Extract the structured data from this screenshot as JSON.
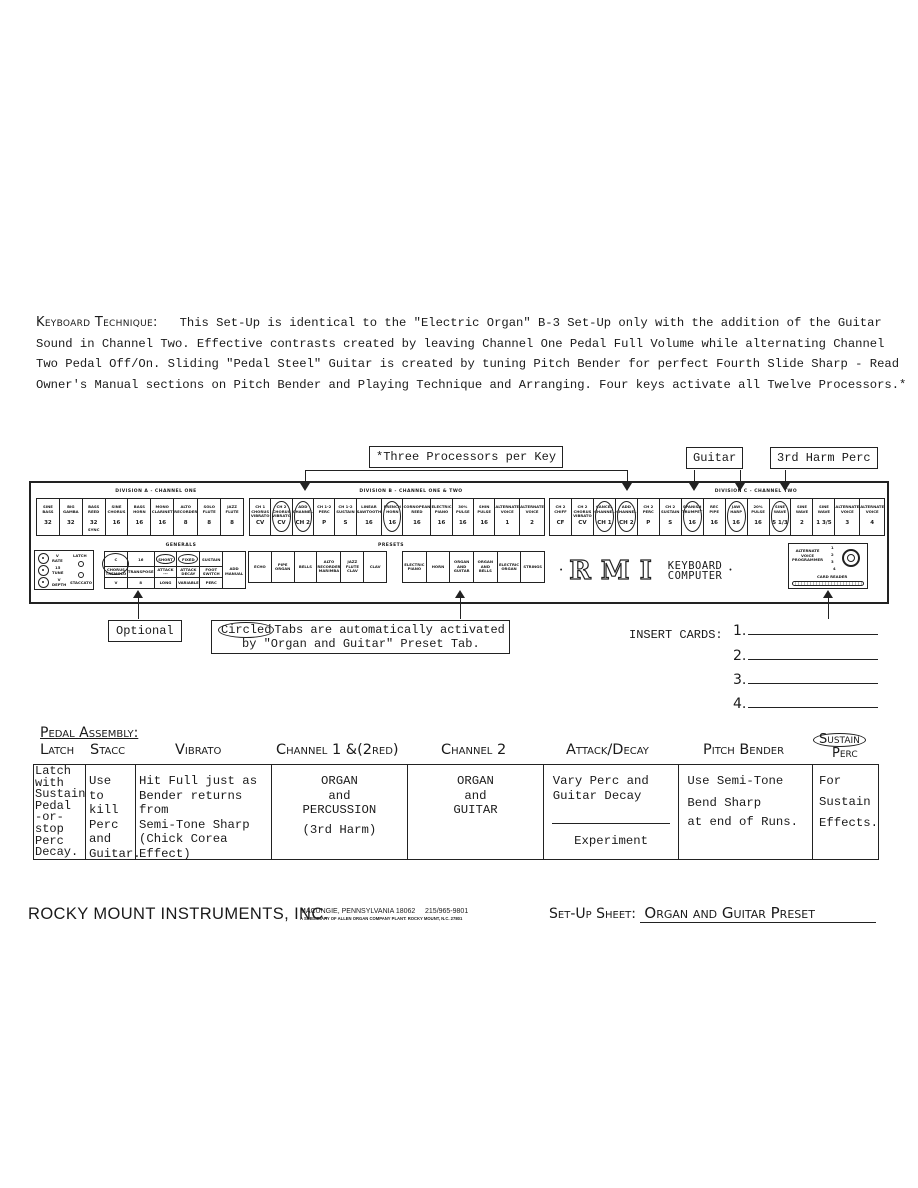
{
  "keyboard_technique": {
    "heading": "Keyboard Technique:",
    "lines": [
      "This Set-Up is identical to the \"Electric Organ\" B-3 Set-Up only with the addition of the Guitar",
      "Sound in Channel Two.  Effective contrasts created by leaving Channel One Pedal Full Volume while alternating Channel",
      "Two Pedal Off/On.  Sliding \"Pedal Steel\" Guitar is created by tuning Pitch Bender for perfect Fourth Slide Sharp - Read",
      "Owner's Manual sections on Pitch Bender and Playing Technique and Arranging.  Four keys activate all Twelve Processors.*"
    ]
  },
  "callouts": {
    "three_processors": "*Three Processors per Key",
    "guitar": "Guitar",
    "third_harm": "3rd Harm Perc",
    "optional": "Optional",
    "circled_word": "Circled",
    "circled_rest": "Tabs are automatically activated",
    "circled_line2": "by \"Organ and Guitar\" Preset Tab."
  },
  "panel": {
    "division_a": {
      "label": "DIVISION A - CHANNEL ONE",
      "tabs": [
        {
          "name": "SINE\nBASS",
          "value": "32"
        },
        {
          "name": "BIG\nGAMBA",
          "value": "32"
        },
        {
          "name": "BASS\nREED",
          "value": "32",
          "extra": "SYNC"
        },
        {
          "name": "SINE\nCHORUS",
          "value": "16"
        },
        {
          "name": "BASS\nHORN",
          "value": "16"
        },
        {
          "name": "MONO\nCLARINET",
          "value": "16"
        },
        {
          "name": "ALTO\nRECORDER",
          "value": "8"
        },
        {
          "name": "SOLO\nFLUTE",
          "value": "8"
        },
        {
          "name": "JAZZ\nFLUTE",
          "value": "8"
        }
      ]
    },
    "division_b": {
      "label": "DIVISION B - CHANNEL ONE & TWO",
      "tabs": [
        {
          "name": "CH 1\nCHORUS\nVIBRATO",
          "value": "CV"
        },
        {
          "name": "CH 2\nCHORUS\nVIBRATO",
          "value": "CV",
          "circled": true
        },
        {
          "name": "ADD\nCHANNEL",
          "value": "CH 2",
          "circled": true
        },
        {
          "name": "CH 1-2\nPERC",
          "value": "P"
        },
        {
          "name": "CH 1-2\nSUSTAIN",
          "value": "S"
        },
        {
          "name": "LINEAR\nSAWTOOTH",
          "value": "16"
        },
        {
          "name": "FRENCH\nHORN",
          "value": "16",
          "circled": true
        },
        {
          "name": "CORNOPEAN\nREED",
          "value": "16"
        },
        {
          "name": "ELECTRIC\nPIANO",
          "value": "16"
        },
        {
          "name": "30%\nPULSE",
          "value": "16"
        },
        {
          "name": "SHIN\nPULSE",
          "value": "16"
        },
        {
          "name": "ALTERNATE\nVOICE",
          "value": "1"
        },
        {
          "name": "ALTERNATE\nVOICE",
          "value": "2"
        }
      ]
    },
    "division_c": {
      "label": "DIVISION C - CHANNEL TWO",
      "tabs": [
        {
          "name": "CH 2\nCHIFF",
          "value": "CF"
        },
        {
          "name": "CH 2\nCHORUS\nVIBRATO",
          "value": "CV"
        },
        {
          "name": "CANCEL\nCHANNEL",
          "value": "CH 1",
          "circled": true
        },
        {
          "name": "ADD\nCHANNEL",
          "value": "CH 2",
          "circled": true
        },
        {
          "name": "CH 2\nPERC",
          "value": "P"
        },
        {
          "name": "CH 2\nSUSTAIN",
          "value": "S"
        },
        {
          "name": "SPANISH\nTRUMPET",
          "value": "16",
          "circled": true
        },
        {
          "name": "REC\nPIPE",
          "value": "16"
        },
        {
          "name": "JAW\nHARP",
          "value": "16",
          "circled": true
        },
        {
          "name": "20%\nPULSE",
          "value": "16"
        },
        {
          "name": "SINE\nWAVE",
          "value": "5 1/3",
          "circled": true
        },
        {
          "name": "SINE\nWAVE",
          "value": "2"
        },
        {
          "name": "SINE\nWAVE",
          "value": "1 3/5"
        },
        {
          "name": "ALTERNATE\nVOICE",
          "value": "3"
        },
        {
          "name": "ALTERNATE\nVOICE",
          "value": "4"
        }
      ]
    },
    "controls": {
      "knobs": [
        {
          "label": "V\nRATE"
        },
        {
          "label": "15\nTUNE"
        },
        {
          "label": "V\nDEPTH"
        }
      ],
      "latch": "LATCH",
      "staccato": "STACCATO"
    },
    "generals": {
      "label": "GENERALS",
      "tabs": [
        {
          "top": "C",
          "mid": "CHORUS\nTREMOLO",
          "bot": "V",
          "circled": true
        },
        {
          "top": "16",
          "mid": "TRANSPOSE",
          "bot": "8"
        },
        {
          "top": "SHORT",
          "mid": "ATTACK\n---",
          "bot": "LONG",
          "circled": true
        },
        {
          "top": "FIXED",
          "mid": "ATTACK\nDECAY",
          "bot": "VARIABLE",
          "circled": true
        },
        {
          "top": "SUSTAIN",
          "mid": "FOOT\nSWITCH",
          "bot": "PERC"
        },
        {
          "top": "",
          "mid": "ADD\nMANUAL",
          "bot": ""
        }
      ]
    },
    "presets": {
      "label": "PRESETS",
      "group1": [
        "ECHO",
        "PIPE\nORGAN",
        "BELLS",
        "ALTO\nRECORDER\nMARIMBA",
        "JAZZ\nFLUTE\nCLAV",
        "CLAV"
      ],
      "group2": [
        "ELECTRIC\nPIANO",
        "HORN",
        "ORGAN\nAND\nGUITAR",
        "ORGAN\nAND\nBELLS",
        "ELECTRIC\nORGAN",
        "STRINGS"
      ]
    },
    "logo": {
      "brand": "RMI",
      "line1": "KEYBOARD",
      "line2": "COMPUTER"
    },
    "card_reader": {
      "label": "ALTERNATE\nVOICE\nPROGRAMMER",
      "numbers": [
        "1",
        "2",
        "3",
        "4"
      ],
      "reader_label": "CARD READER"
    }
  },
  "insert_cards": {
    "label": "INSERT CARDS:",
    "slots": [
      "1.",
      "2.",
      "3.",
      "4."
    ]
  },
  "pedal_assembly": {
    "title": "Pedal Assembly:",
    "headers": [
      "Latch",
      "Stacc",
      "Vibrato",
      "Channel 1 &(2red)",
      "Channel 2",
      "Attack/Decay",
      "Pitch Bender",
      "Sustain",
      "Perc"
    ],
    "cells": {
      "latch": "Latch\nwith\nSustain\nPedal\n-or-\nstop\nPerc\nDecay.",
      "stacc": "Use to\nkill\nPerc\nand\nGuitar.",
      "vibrato": "Hit Full just as\nBender returns from\nSemi-Tone Sharp\n(Chick Corea Effect)",
      "channel1": "ORGAN\nand\nPERCUSSION",
      "channel1_note": "(3rd Harm)",
      "channel2": "ORGAN\nand\nGUITAR",
      "attack_top": "Vary Perc and\nGuitar Decay",
      "attack_bottom": "Experiment",
      "pitch1": "Use Semi-Tone",
      "pitch2": "Bend Sharp",
      "pitch3": "at end of Runs.",
      "sustain": "For\nSustain\nEffects."
    }
  },
  "footer": {
    "company": "ROCKY MOUNT INSTRUMENTS, INC.",
    "address_line1": "MACUNGIE, PENNSYLVANIA 18062     215/965-9801",
    "address_line2": "A SUBSIDIARY OF ALLEN ORGAN COMPANY   PLANT: ROCKY MOUNT, N.C. 27801",
    "setup_label": "Set-Up Sheet:",
    "setup_value": "Organ and Guitar Preset"
  }
}
